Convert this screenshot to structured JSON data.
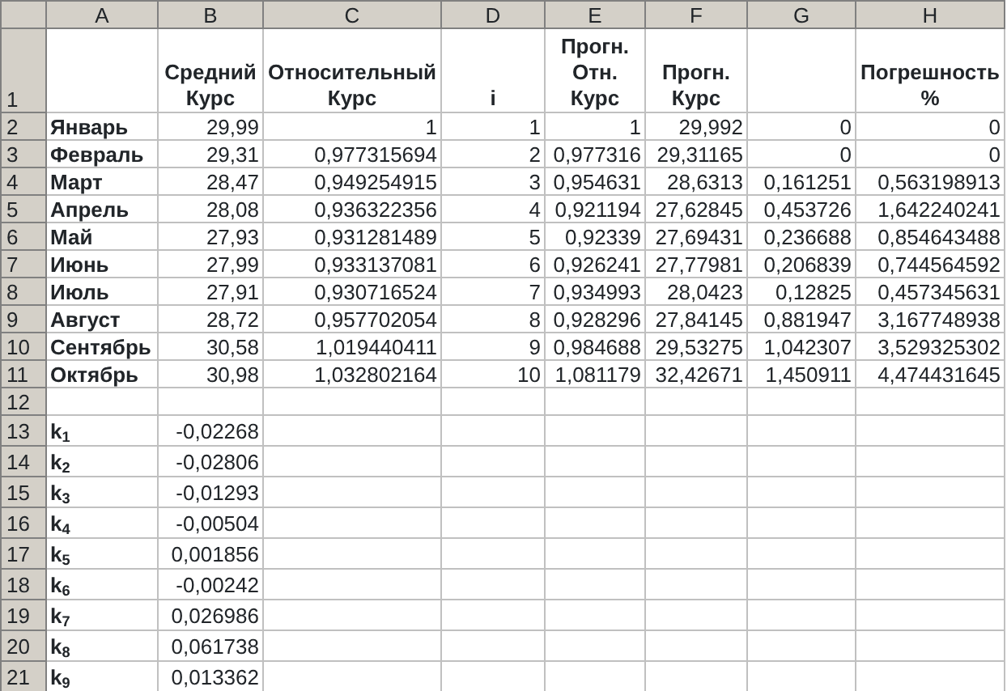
{
  "column_headers": [
    "A",
    "B",
    "C",
    "D",
    "E",
    "F",
    "G",
    "H"
  ],
  "rows": [
    {
      "number": "1",
      "kind": "header",
      "cells": [
        null,
        "Средний Курс",
        "Относительный Курс",
        "i",
        "Прогн. Отн. Курс",
        "Прогн. Курс",
        null,
        "Погрешность %"
      ]
    },
    {
      "number": "2",
      "kind": "data",
      "cells": [
        "Январь",
        "29,99",
        "1",
        "1",
        "1",
        "29,992",
        "0",
        "0"
      ]
    },
    {
      "number": "3",
      "kind": "data",
      "cells": [
        "Февраль",
        "29,31",
        "0,977315694",
        "2",
        "0,977316",
        "29,31165",
        "0",
        "0"
      ]
    },
    {
      "number": "4",
      "kind": "data",
      "cells": [
        "Март",
        "28,47",
        "0,949254915",
        "3",
        "0,954631",
        "28,6313",
        "0,161251",
        "0,563198913"
      ]
    },
    {
      "number": "5",
      "kind": "data",
      "cells": [
        "Апрель",
        "28,08",
        "0,936322356",
        "4",
        "0,921194",
        "27,62845",
        "0,453726",
        "1,642240241"
      ]
    },
    {
      "number": "6",
      "kind": "data",
      "cells": [
        "Май",
        "27,93",
        "0,931281489",
        "5",
        "0,92339",
        "27,69431",
        "0,236688",
        "0,854643488"
      ]
    },
    {
      "number": "7",
      "kind": "data",
      "cells": [
        "Июнь",
        "27,99",
        "0,933137081",
        "6",
        "0,926241",
        "27,77981",
        "0,206839",
        "0,744564592"
      ]
    },
    {
      "number": "8",
      "kind": "data",
      "cells": [
        "Июль",
        "27,91",
        "0,930716524",
        "7",
        "0,934993",
        "28,0423",
        "0,12825",
        "0,457345631"
      ]
    },
    {
      "number": "9",
      "kind": "data",
      "cells": [
        "Август",
        "28,72",
        "0,957702054",
        "8",
        "0,928296",
        "27,84145",
        "0,881947",
        "3,167748938"
      ]
    },
    {
      "number": "10",
      "kind": "data",
      "cells": [
        "Сентябрь",
        "30,58",
        "1,019440411",
        "9",
        "0,984688",
        "29,53275",
        "1,042307",
        "3,529325302"
      ]
    },
    {
      "number": "11",
      "kind": "data",
      "cells": [
        "Октябрь",
        "30,98",
        "1,032802164",
        "10",
        "1,081179",
        "32,42671",
        "1,450911",
        "4,474431645"
      ]
    },
    {
      "number": "12",
      "kind": "data",
      "cells": [
        null,
        null,
        null,
        null,
        null,
        null,
        null,
        null
      ]
    },
    {
      "number": "13",
      "kind": "coef",
      "cells": [
        "k$_{1}$",
        "-0,02268",
        null,
        null,
        null,
        null,
        null,
        null
      ]
    },
    {
      "number": "14",
      "kind": "coef",
      "cells": [
        "k$_{2}$",
        "-0,02806",
        null,
        null,
        null,
        null,
        null,
        null
      ]
    },
    {
      "number": "15",
      "kind": "coef",
      "cells": [
        "k$_{3}$",
        "-0,01293",
        null,
        null,
        null,
        null,
        null,
        null
      ]
    },
    {
      "number": "16",
      "kind": "coef",
      "cells": [
        "k$_{4}$",
        "-0,00504",
        null,
        null,
        null,
        null,
        null,
        null
      ]
    },
    {
      "number": "17",
      "kind": "coef",
      "cells": [
        "k$_{5}$",
        "0,001856",
        null,
        null,
        null,
        null,
        null,
        null
      ]
    },
    {
      "number": "18",
      "kind": "coef",
      "cells": [
        "k$_{6}$",
        "-0,00242",
        null,
        null,
        null,
        null,
        null,
        null
      ]
    },
    {
      "number": "19",
      "kind": "coef",
      "cells": [
        "k$_{7}$",
        "0,026986",
        null,
        null,
        null,
        null,
        null,
        null
      ]
    },
    {
      "number": "20",
      "kind": "coef",
      "cells": [
        "k$_{8}$",
        "0,061738",
        null,
        null,
        null,
        null,
        null,
        null
      ]
    },
    {
      "number": "21",
      "kind": "coef",
      "cells": [
        "k$_{9}$",
        "0,013362",
        null,
        null,
        null,
        null,
        null,
        null
      ]
    }
  ]
}
